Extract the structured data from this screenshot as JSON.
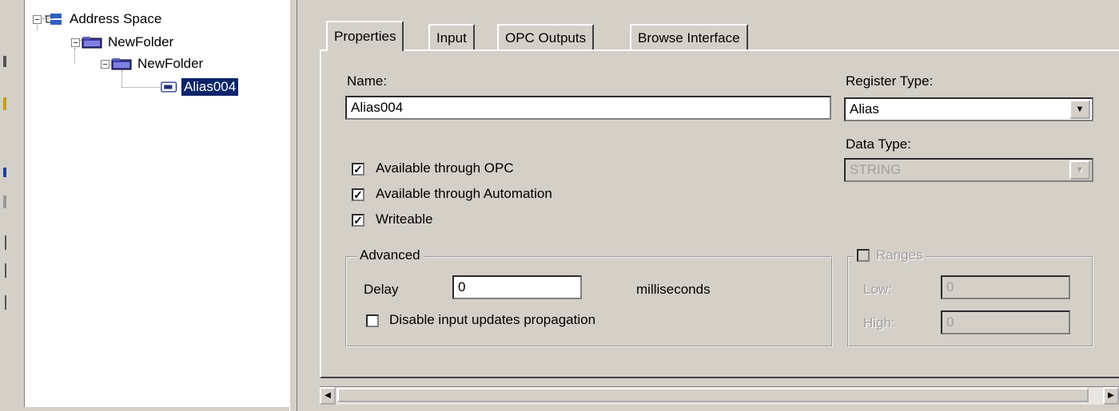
{
  "tree": {
    "root": "Address Space",
    "folder1": "NewFolder",
    "folder2": "NewFolder",
    "item": "Alias004",
    "expander_symbol": "−"
  },
  "tabs": [
    "Properties",
    "Input",
    "OPC Outputs",
    "Browse Interface"
  ],
  "form": {
    "name_label": "Name:",
    "name_value": "Alias004",
    "register_type_label": "Register Type:",
    "register_type_value": "Alias",
    "data_type_label": "Data Type:",
    "data_type_value": "STRING",
    "cb_opc": "Available through OPC",
    "cb_automation": "Available through Automation",
    "cb_writeable": "Writeable",
    "advanced_title": "Advanced",
    "delay_label": "Delay",
    "delay_value": "0",
    "delay_unit": "milliseconds",
    "disable_label": "Disable input updates propagation",
    "ranges_title": "Ranges",
    "low_label": "Low:",
    "low_value": "0",
    "high_label": "High:",
    "high_value": "0"
  },
  "checks": {
    "opc": true,
    "automation": true,
    "writeable": true,
    "disable_propagation": false,
    "ranges": false
  },
  "glyphs": {
    "check": "✓",
    "dropdown": "▼",
    "scroll_left": "◀",
    "scroll_right": "▶"
  },
  "colors": {
    "selection": "#0a246a",
    "dialog": "#d4d0c8"
  }
}
